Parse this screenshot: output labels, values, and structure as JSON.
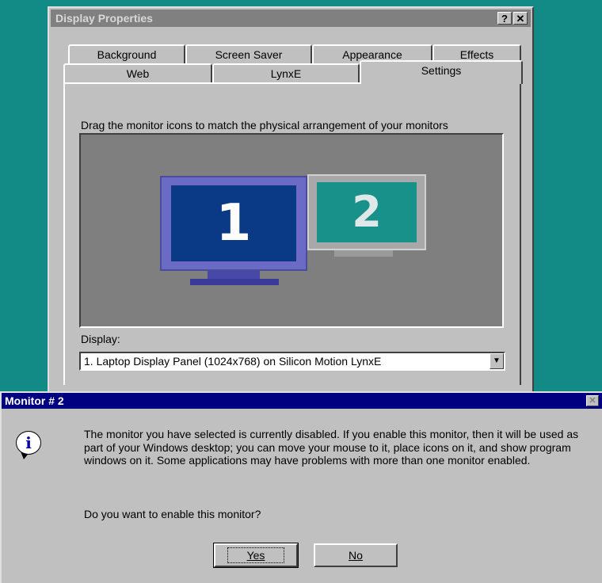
{
  "display_properties": {
    "title": "Display Properties",
    "help_button": "?",
    "close_button": "✕",
    "tabs_back_row": [
      "Background",
      "Screen Saver",
      "Appearance",
      "Effects"
    ],
    "tabs_front_row": [
      "Web",
      "LynxE",
      "Settings"
    ],
    "active_tab": "Settings",
    "instruction": "Drag the monitor icons to match the physical arrangement of your monitors",
    "monitors": [
      {
        "number": "1",
        "color": "#0a3a86"
      },
      {
        "number": "2",
        "color": "#18918a"
      }
    ],
    "display_label": "Display:",
    "display_value": "1. Laptop Display Panel (1024x768) on Silicon Motion LynxE",
    "combo_arrow": "▼"
  },
  "dialog": {
    "title": "Monitor # 2",
    "close_button": "✕",
    "icon": "information-icon",
    "icon_glyph": "i",
    "message": "The monitor you have selected is currently disabled. If you enable this monitor, then it will be used as part of your Windows desktop; you can move your mouse to it, place icons on it, and show program windows on it.  Some applications may have problems with more than one monitor enabled.",
    "question": "Do you want to enable this monitor?",
    "yes_button": "Yes",
    "no_button": "No"
  },
  "colors": {
    "desktop": "#128b86",
    "dialog_titlebar": "#000080",
    "inactive_titlebar": "#808080",
    "face": "#c0c0c0"
  }
}
